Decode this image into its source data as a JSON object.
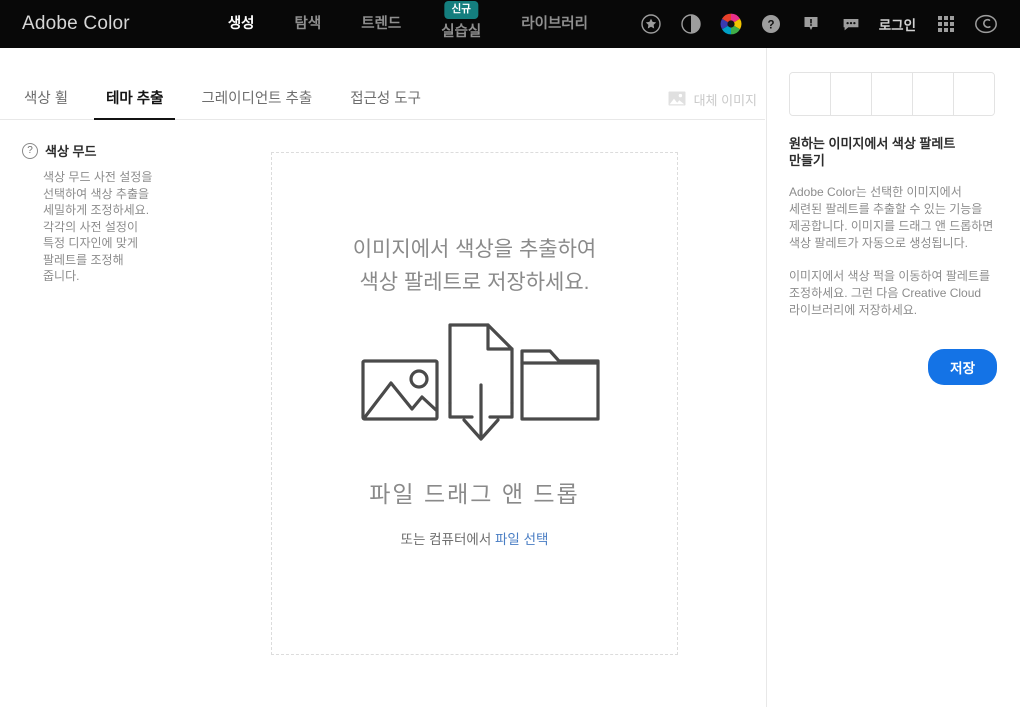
{
  "header": {
    "brand": "Adobe Color",
    "nav": [
      {
        "label": "생성",
        "active": true,
        "badge": null
      },
      {
        "label": "탐색",
        "active": false,
        "badge": null
      },
      {
        "label": "트렌드",
        "active": false,
        "badge": null
      },
      {
        "label": "실습실",
        "active": false,
        "badge": "신규"
      },
      {
        "label": "라이브러리",
        "active": false,
        "badge": null
      }
    ],
    "icons": [
      "star-icon",
      "contrast-icon",
      "color-wheel-icon",
      "help-icon",
      "feedback-icon",
      "comment-icon"
    ],
    "login_label": "로그인",
    "app-grid": "app-grid-icon",
    "cc_logo": "creative-cloud-icon",
    "background_color": "#080808",
    "badge_color": "#147e7e"
  },
  "subtabs": {
    "items": [
      {
        "label": "색상 휠",
        "active": false
      },
      {
        "label": "테마 추출",
        "active": true
      },
      {
        "label": "그레이디언트 추출",
        "active": false
      },
      {
        "label": "접근성 도구",
        "active": false
      }
    ],
    "alt_image_label": "대체 이미지"
  },
  "sidebar": {
    "help_icon": "question-mark-icon",
    "title": "색상 무드",
    "description": "색상 무드 사전 설정을 선택하여 색상 추출을 세밀하게 조정하세요. 각각의 사전 설정이 특정 디자인에 맞게 팔레트를 조정해 줍니다."
  },
  "dropzone": {
    "headline": "이미지에서 색상을 추출하여 색상 팔레트로 저장하세요.",
    "art_icons": [
      "image-icon",
      "document-download-icon",
      "folder-icon"
    ],
    "drag_label": "파일 드래그 앤 드롭",
    "sub_prefix": "또는 컴퓨터에서 ",
    "sub_link": "파일 선택",
    "link_color": "#4a7ec4"
  },
  "right_panel": {
    "swatches": [
      "#ffffff",
      "#ffffff",
      "#ffffff",
      "#ffffff",
      "#ffffff"
    ],
    "title": "원하는 이미지에서 색상 팔레트 만들기",
    "paragraph1": "Adobe Color는 선택한 이미지에서 세련된 팔레트를 추출할 수 있는 기능을 제공합니다. 이미지를 드래그 앤 드롭하면 색상 팔레트가 자동으로 생성됩니다.",
    "paragraph2": "이미지에서 색상 퍽을 이동하여 팔레트를 조정하세요. 그런 다음 Creative Cloud 라이브러리에 저장하세요.",
    "save_label": "저장",
    "save_color": "#1473e6"
  }
}
